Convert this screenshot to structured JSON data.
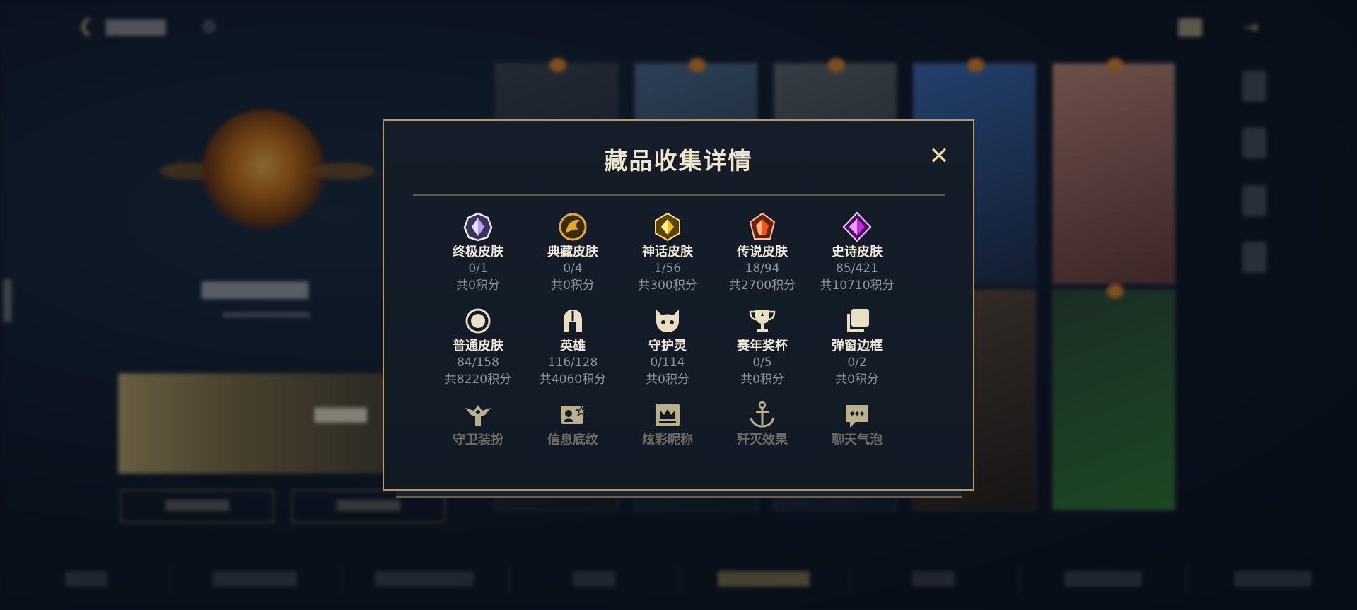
{
  "modal": {
    "title": "藏品收集详情",
    "close_label": "✕",
    "items": [
      {
        "name": "终极皮肤",
        "count": "0/1",
        "score": "共0积分",
        "icon": "ultimate-skin-icon",
        "color": "#b8a3e6"
      },
      {
        "name": "典藏皮肤",
        "count": "0/4",
        "score": "共0积分",
        "icon": "prestige-skin-icon",
        "color": "#e5a92e"
      },
      {
        "name": "神话皮肤",
        "count": "1/56",
        "score": "共300积分",
        "icon": "mythic-skin-icon",
        "color": "#f1c31a"
      },
      {
        "name": "传说皮肤",
        "count": "18/94",
        "score": "共2700积分",
        "icon": "legendary-skin-icon",
        "color": "#e8591c"
      },
      {
        "name": "史诗皮肤",
        "count": "85/421",
        "score": "共10710积分",
        "icon": "epic-skin-icon",
        "color": "#c129e0"
      },
      {
        "name": "普通皮肤",
        "count": "84/158",
        "score": "共8220积分",
        "icon": "standard-skin-icon",
        "color": "#e9e0c4"
      },
      {
        "name": "英雄",
        "count": "116/128",
        "score": "共4060积分",
        "icon": "champion-helmet-icon",
        "color": "#e9e0c4"
      },
      {
        "name": "守护灵",
        "count": "0/114",
        "score": "共0积分",
        "icon": "guardian-spirit-icon",
        "color": "#e9e0c4"
      },
      {
        "name": "赛年奖杯",
        "count": "0/5",
        "score": "共0积分",
        "icon": "trophy-icon",
        "color": "#e9e0c4"
      },
      {
        "name": "弹窗边框",
        "count": "0/2",
        "score": "共0积分",
        "icon": "popup-frame-icon",
        "color": "#e9e0c4"
      },
      {
        "name": "守卫装扮",
        "icon": "ward-skin-icon",
        "color": "#d8caa0"
      },
      {
        "name": "信息底纹",
        "icon": "info-card-icon",
        "color": "#d8caa0"
      },
      {
        "name": "炫彩昵称",
        "icon": "colorful-nickname-icon",
        "color": "#d8caa0"
      },
      {
        "name": "歼灭效果",
        "icon": "elimination-effect-icon",
        "color": "#d8caa0"
      },
      {
        "name": "聊天气泡",
        "icon": "chat-bubble-icon",
        "color": "#d8caa0"
      }
    ]
  }
}
